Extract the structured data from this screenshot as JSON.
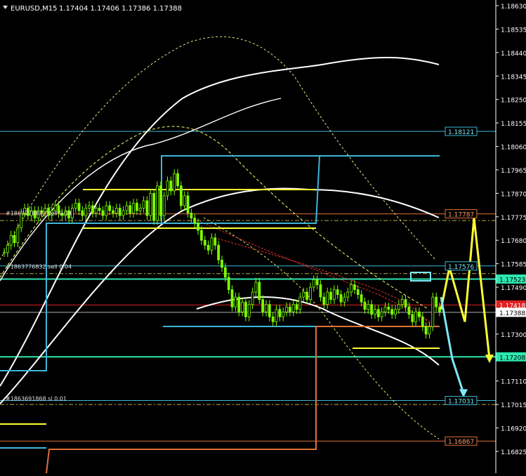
{
  "header": {
    "symbol_timeframe": "EURUSD,M15",
    "ohlc": "1.17404 1.17406 1.17386 1.17388",
    "menu_icon": "triangle-down-icon"
  },
  "order_labels": [
    {
      "text": "#1863776832 sell 0.04",
      "price": 1.17776
    },
    {
      "text": "#1863776832 sell 0.04",
      "price": 1.1756
    },
    {
      "text": "#1863691868 sl 0.01",
      "price": 1.17026
    }
  ],
  "colors": {
    "background": "#000000",
    "candle": "#7CFC00",
    "cyan_level": "#3FB6D9",
    "orange_level": "#E0703A",
    "teal_level": "#2CE8B0",
    "yellow": "#FFFF33",
    "arrow_cyan": "#7FE7F5",
    "bid_line": "#B0B0B0",
    "red_level": "#E02020"
  },
  "chart_data": {
    "type": "candlestick",
    "symbol": "EURUSD",
    "timeframe": "M15",
    "ylim": [
      1.1679,
      1.1865
    ],
    "y_ticks": [
      "1.18630",
      "1.18535",
      "1.18440",
      "1.18345",
      "1.18250",
      "1.18155",
      "1.18060",
      "1.17965",
      "1.17870",
      "1.17775",
      "1.17680",
      "1.17585",
      "1.17490",
      "1.17395",
      "1.17300",
      "1.17205",
      "1.17110",
      "1.17015",
      "1.16920",
      "1.16825"
    ],
    "price_tags": [
      {
        "label": "1.18121",
        "value": 1.18121,
        "style": "cyan"
      },
      {
        "label": "1.17787",
        "value": 1.17787,
        "style": "orange"
      },
      {
        "label": "1.17576",
        "value": 1.17576,
        "style": "cyan"
      },
      {
        "label": "1.17523",
        "value": 1.17523,
        "style": "teal-filled"
      },
      {
        "label": "1.17418",
        "value": 1.17418,
        "style": "red-filled"
      },
      {
        "label": "1.17388",
        "value": 1.17388,
        "style": "bid-filled"
      },
      {
        "label": "1.17208",
        "value": 1.17208,
        "style": "teal-filled"
      },
      {
        "label": "1.17031",
        "value": 1.17031,
        "style": "cyan"
      },
      {
        "label": "1.16867",
        "value": 1.16867,
        "style": "orange"
      }
    ],
    "candles_close": [
      1.1763,
      1.1766,
      1.177,
      1.1767,
      1.1773,
      1.1779,
      1.1781,
      1.1778,
      1.178,
      1.1777,
      1.178,
      1.1779,
      1.1781,
      1.1778,
      1.178,
      1.1782,
      1.1779,
      1.1778,
      1.178,
      1.1777,
      1.1781,
      1.1783,
      1.178,
      1.1778,
      1.1781,
      1.1782,
      1.1779,
      1.1781,
      1.178,
      1.1778,
      1.1782,
      1.178,
      1.1779,
      1.1781,
      1.1778,
      1.178,
      1.1782,
      1.1779,
      1.1783,
      1.178,
      1.1781,
      1.1784,
      1.1778,
      1.1787,
      1.1776,
      1.179,
      1.1778,
      1.1786,
      1.1792,
      1.1788,
      1.1795,
      1.179,
      1.1782,
      1.1786,
      1.1779,
      1.1777,
      1.1775,
      1.1772,
      1.1768,
      1.1766,
      1.1764,
      1.1769,
      1.1766,
      1.176,
      1.1757,
      1.1753,
      1.1748,
      1.1741,
      1.1745,
      1.1739,
      1.1743,
      1.1737,
      1.1742,
      1.1747,
      1.1751,
      1.1744,
      1.1739,
      1.1742,
      1.1737,
      1.1735,
      1.174,
      1.1737,
      1.1739,
      1.1741,
      1.1739,
      1.1742,
      1.174,
      1.1745,
      1.1747,
      1.1744,
      1.1749,
      1.1752,
      1.175,
      1.1745,
      1.1742,
      1.1747,
      1.1744,
      1.1748,
      1.1746,
      1.1743,
      1.1745,
      1.1747,
      1.175,
      1.1748,
      1.1746,
      1.1743,
      1.174,
      1.1742,
      1.1738,
      1.174,
      1.1737,
      1.1739,
      1.1741,
      1.174,
      1.1738,
      1.174,
      1.1742,
      1.1744,
      1.1741,
      1.1738,
      1.1735,
      1.1739,
      1.1737,
      1.1733,
      1.173,
      1.1733,
      1.1745,
      1.1741,
      1.1739
    ],
    "horizontal_levels": [
      {
        "value": 1.18121,
        "color": "cyan"
      },
      {
        "value": 1.17787,
        "color": "orange"
      },
      {
        "value": 1.17576,
        "color": "cyan"
      },
      {
        "value": 1.17523,
        "color": "teal"
      },
      {
        "value": 1.17418,
        "color": "red"
      },
      {
        "value": 1.17388,
        "color": "bid"
      },
      {
        "value": 1.17208,
        "color": "teal"
      },
      {
        "value": 1.17031,
        "color": "cyan"
      },
      {
        "value": 1.16867,
        "color": "orange"
      }
    ],
    "projection": {
      "yellow_path": [
        1.174,
        1.1757,
        1.1735,
        1.1777,
        1.172
      ],
      "cyan_path": [
        1.1745,
        1.172,
        1.1706
      ]
    }
  }
}
